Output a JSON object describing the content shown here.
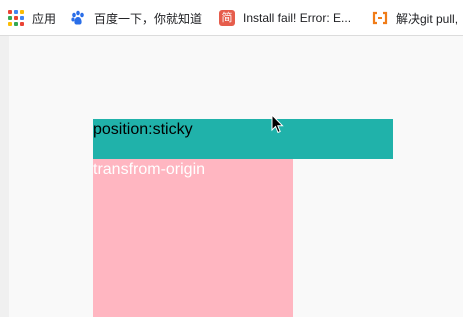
{
  "bookmarks": {
    "apps_label": "应用",
    "baidu_label": "百度一下，你就知道",
    "install_label": "Install fail! Error: E...",
    "install_icon_glyph": "简",
    "git_label": "解决git pull,"
  },
  "content": {
    "sticky_text": "position:sticky",
    "pink_text": "transfrom-origin"
  },
  "colors": {
    "sticky_bg": "#20b2aa",
    "pink_bg": "#ffb6c1",
    "install_icon_bg": "#e65d4c",
    "git_icon": "#f07c18",
    "baidu_icon": "#2a6ee8"
  }
}
